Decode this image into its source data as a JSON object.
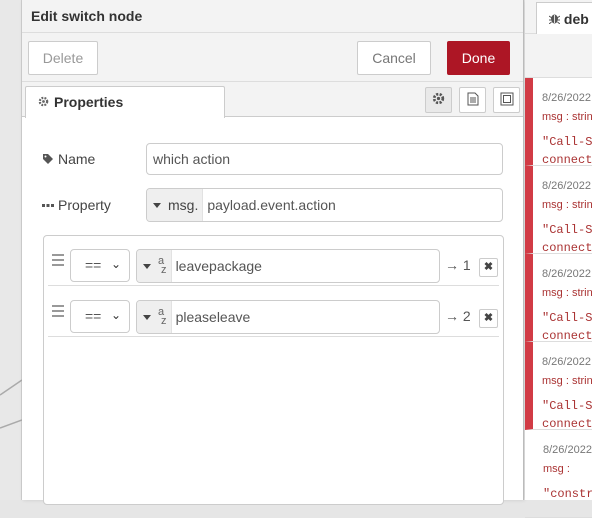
{
  "tray": {
    "title": "Edit switch node",
    "delete_label": "Delete",
    "cancel_label": "Cancel",
    "done_label": "Done",
    "tab_properties": "Properties"
  },
  "form": {
    "name_label": "Name",
    "name_value": "which action",
    "property_label": "Property",
    "property_type": "msg.",
    "property_value": "payload.event.action"
  },
  "rules": [
    {
      "operator": "==",
      "type_icon": "a-z",
      "value": "leavepackage",
      "output": "→ 1"
    },
    {
      "operator": "==",
      "type_icon": "a-z",
      "value": "pleaseleave",
      "output": "→ 2"
    }
  ],
  "sidebar": {
    "tab_label": "deb",
    "messages": [
      {
        "time": "8/26/2022",
        "topic": "msg : strin",
        "line1": "\"Call-S",
        "line2": "connect",
        "error": true
      },
      {
        "time": "8/26/2022",
        "topic": "msg : strin",
        "line1": "\"Call-S",
        "line2": "connect",
        "error": true
      },
      {
        "time": "8/26/2022",
        "topic": "msg : strin",
        "line1": "\"Call-S",
        "line2": "connect",
        "error": true
      },
      {
        "time": "8/26/2022",
        "topic": "msg : strin",
        "line1": "\"Call-S",
        "line2": "connect",
        "error": true
      },
      {
        "time": "8/26/2022",
        "topic": "msg :",
        "line1": "\"constr",
        "line2": "",
        "error": false
      }
    ]
  },
  "colors": {
    "done_button": "#ad1625",
    "error_marker": "#d13b45"
  }
}
